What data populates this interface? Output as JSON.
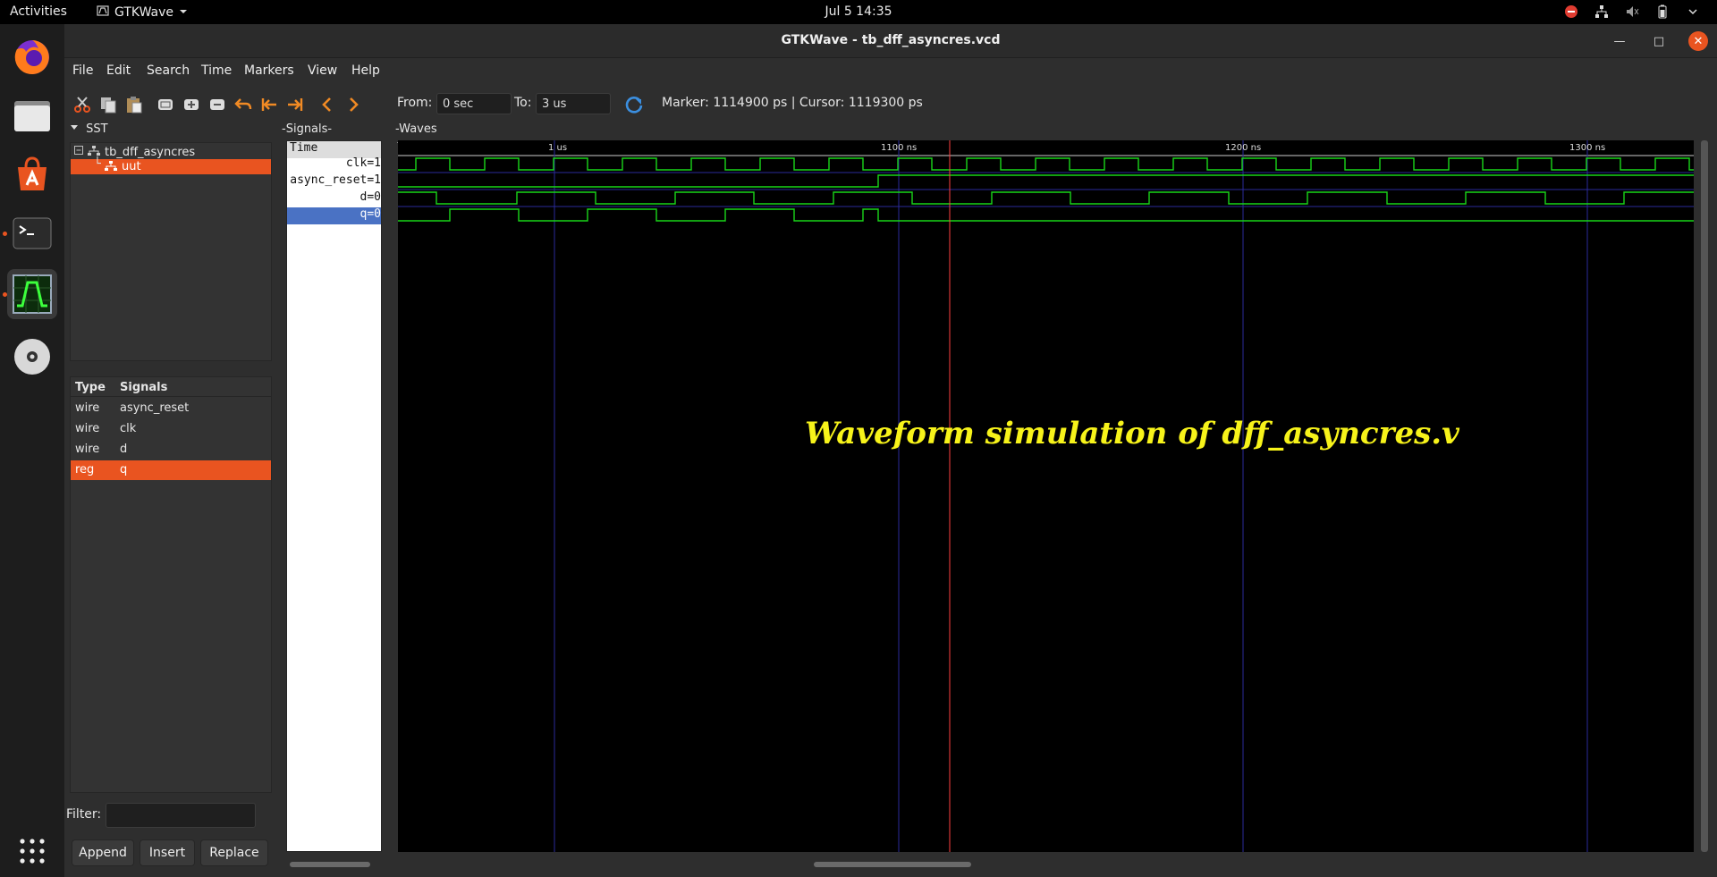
{
  "topbar": {
    "activities": "Activities",
    "app_name": "GTKWave",
    "clock": "Jul 5  14:35"
  },
  "dock": {
    "items": [
      "firefox-icon",
      "files-icon",
      "software-icon",
      "terminal-icon",
      "gtkwave-icon",
      "disc-icon",
      "app-grid-icon"
    ]
  },
  "window": {
    "title": "GTKWave - tb_dff_asyncres.vcd"
  },
  "menu": [
    "File",
    "Edit",
    "Search",
    "Time",
    "Markers",
    "View",
    "Help"
  ],
  "toolbar": {
    "from_label": "From:",
    "from_value": "0 sec",
    "to_label": "To:",
    "to_value": "3 us",
    "marker_text": "Marker: 1114900 ps  |  Cursor: 1119300 ps"
  },
  "sst": {
    "label": "SST",
    "tree": [
      {
        "name": "tb_dff_asyncres"
      },
      {
        "name": "uut"
      }
    ],
    "list_headers": {
      "type": "Type",
      "signals": "Signals"
    },
    "signals": [
      {
        "type": "wire",
        "name": "async_reset"
      },
      {
        "type": "wire",
        "name": "clk"
      },
      {
        "type": "wire",
        "name": "d"
      },
      {
        "type": "reg",
        "name": "q"
      }
    ],
    "filter_label": "Filter:",
    "buttons": {
      "append": "Append",
      "insert": "Insert",
      "replace": "Replace"
    }
  },
  "signals_pane": {
    "label": "Signals",
    "header": "Time",
    "rows": [
      "clk=1",
      "async_reset=1",
      "d=0",
      "q=0"
    ]
  },
  "waves_pane": {
    "label": "Waves",
    "ticks": [
      "1 us",
      "1100 ns",
      "1200 ns",
      "1300 ns"
    ]
  },
  "caption": "Waveform simulation of dff_asyncres.v",
  "colors": {
    "accent": "#e95420",
    "wave": "#19d619",
    "marker": "#ff4040",
    "grid": "#2a2a9a",
    "caption": "#f7f31a",
    "selected_signal": "#4a72c4"
  }
}
